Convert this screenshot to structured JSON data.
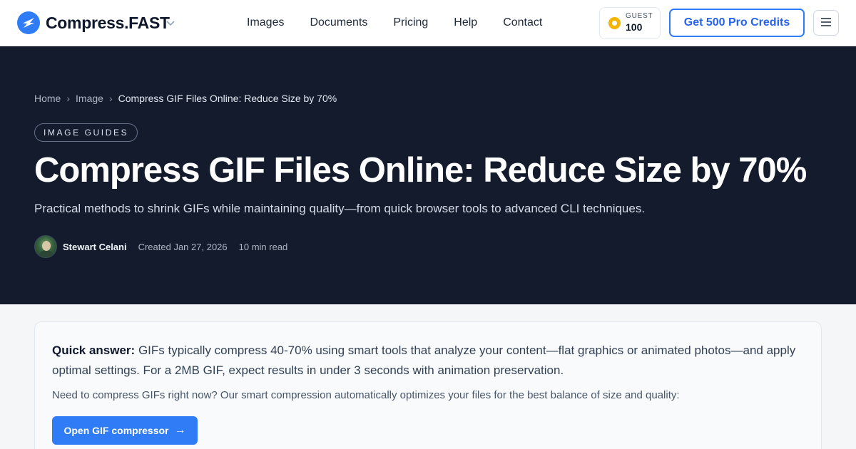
{
  "header": {
    "brand": "Compress.FAST",
    "nav": [
      "Images",
      "Documents",
      "Pricing",
      "Help",
      "Contact"
    ],
    "credits": {
      "label": "GUEST",
      "value": "100"
    },
    "pro_button": "Get 500 Pro Credits"
  },
  "hero": {
    "breadcrumb": [
      "Home",
      "Image",
      "Compress GIF Files Online: Reduce Size by 70%"
    ],
    "tag": "IMAGE GUIDES",
    "title": "Compress GIF Files Online: Reduce Size by 70%",
    "subtitle": "Practical methods to shrink GIFs while maintaining quality—from quick browser tools to advanced CLI techniques.",
    "author": "Stewart Celani",
    "created": "Created Jan 27, 2026",
    "read_time": "10 min read"
  },
  "quick_answer": {
    "label": "Quick answer:",
    "text": " GIFs typically compress 40-70% using smart tools that analyze your content—flat graphics or animated photos—and apply optimal settings. For a 2MB GIF, expect results in under 3 seconds with animation preservation.",
    "note": "Need to compress GIFs right now? Our smart compression automatically optimizes your files for the best balance of size and quality:",
    "cta": "Open GIF compressor",
    "cta_arrow": "→"
  },
  "colors": {
    "accent": "#2f7cf6",
    "hero_bg": "#141b2d",
    "coin": "#f4b400"
  }
}
